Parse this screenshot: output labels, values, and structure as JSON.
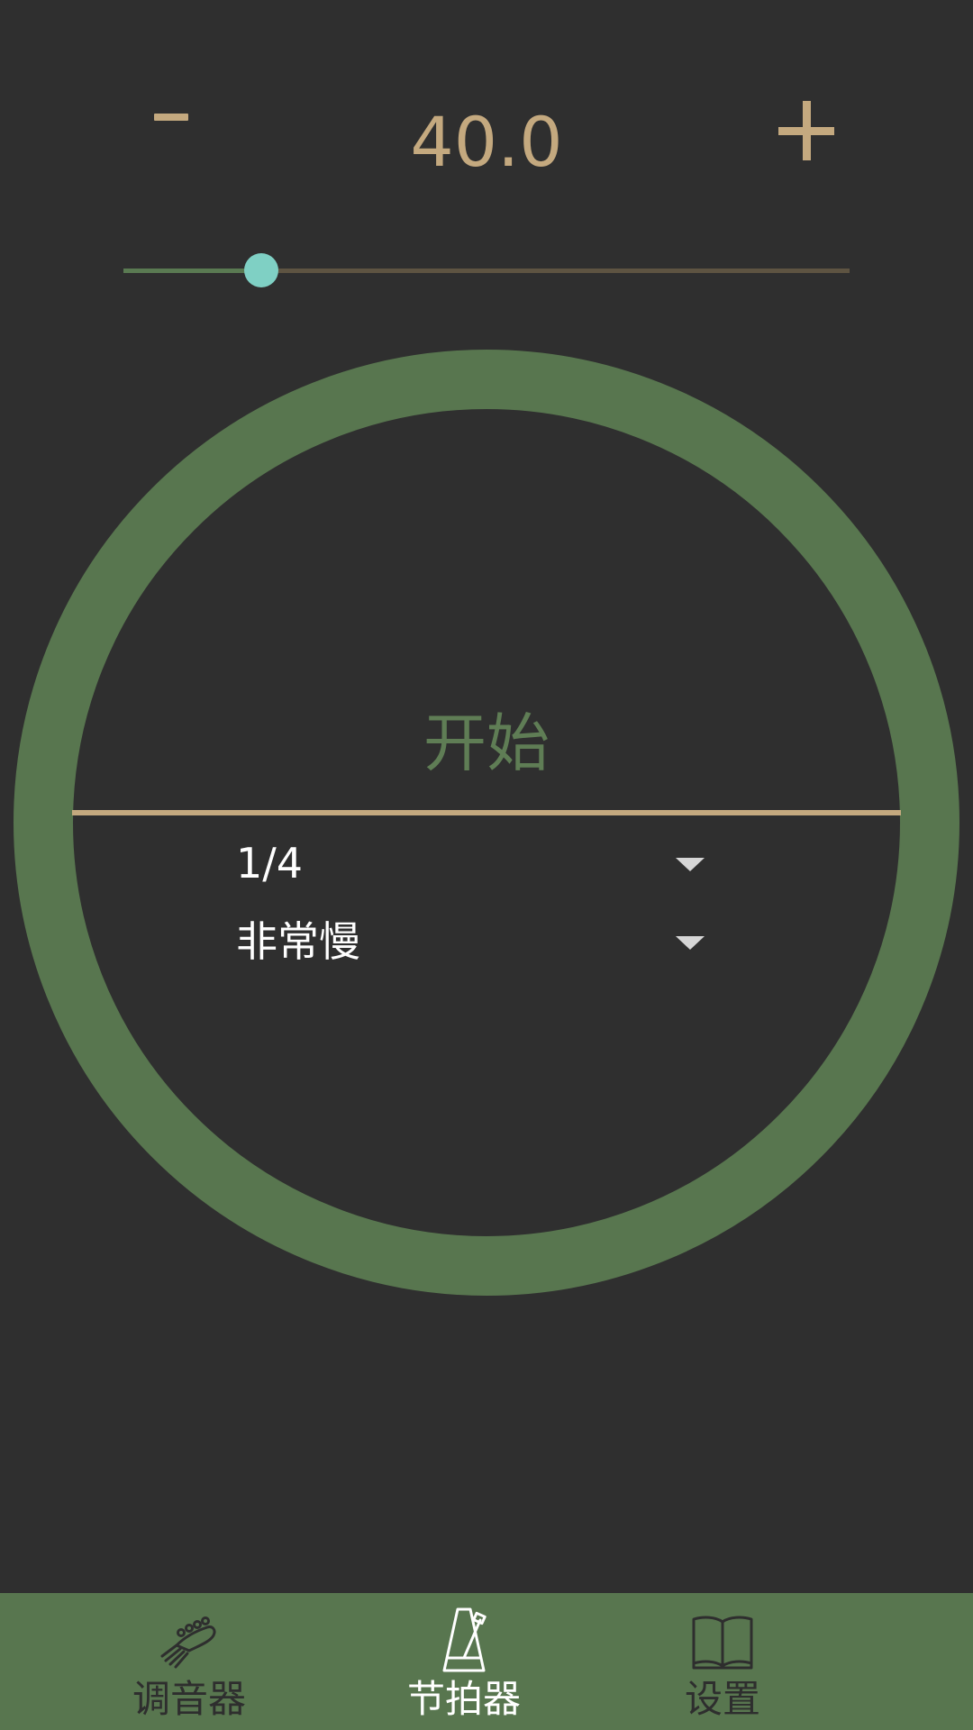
{
  "tempo": {
    "minus_label": "-",
    "plus_label": "+",
    "value": "40.0",
    "slider_level": 0.19
  },
  "metronome": {
    "start_label": "开始",
    "beat_fraction": "1/4",
    "speed_label": "非常慢"
  },
  "nav": {
    "items": [
      {
        "label": "调音器",
        "icon": "guitar-headstock-icon",
        "active": false
      },
      {
        "label": "节拍器",
        "icon": "metronome-icon",
        "active": true
      },
      {
        "label": "设置",
        "icon": "book-icon",
        "active": false
      }
    ]
  },
  "colors": {
    "background": "#2f2f2f",
    "accent_gold": "#c4a97f",
    "ring_green": "#58764f",
    "slider_thumb": "#7fd0c4"
  }
}
